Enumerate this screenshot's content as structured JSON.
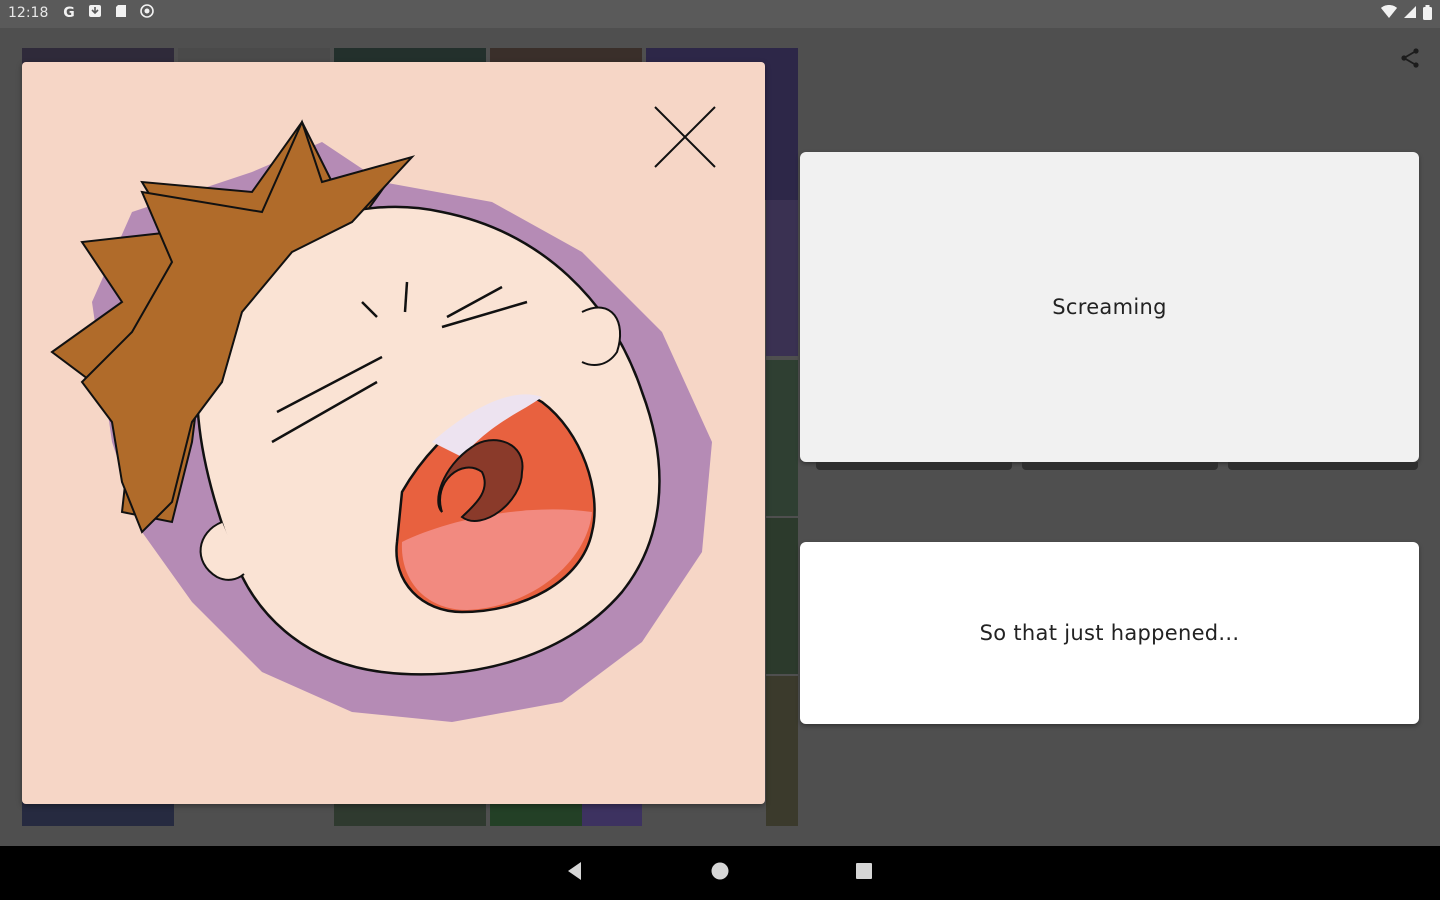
{
  "status_bar": {
    "time": "12:18",
    "left_icons": [
      "google-icon",
      "download-icon",
      "sd-card-icon",
      "circle-status-icon"
    ],
    "right_icons": [
      "wifi-icon",
      "signal-icon",
      "battery-icon"
    ]
  },
  "toolbar": {
    "share_icon": "share-icon"
  },
  "image_card": {
    "image": "crying-baby-illustration",
    "close_icon": "close-icon"
  },
  "cards": {
    "title": "Screaming",
    "caption": "So that just happened..."
  },
  "nav_bar": {
    "back_icon": "back-icon",
    "home_icon": "home-icon",
    "recents_icon": "recents-icon"
  },
  "colors": {
    "background": "#4f4f4f",
    "image_bg": "#f6d6c6",
    "hair": "#b06b2a",
    "shadow_purple": "#b58bb5",
    "mouth": "#e8613f"
  }
}
